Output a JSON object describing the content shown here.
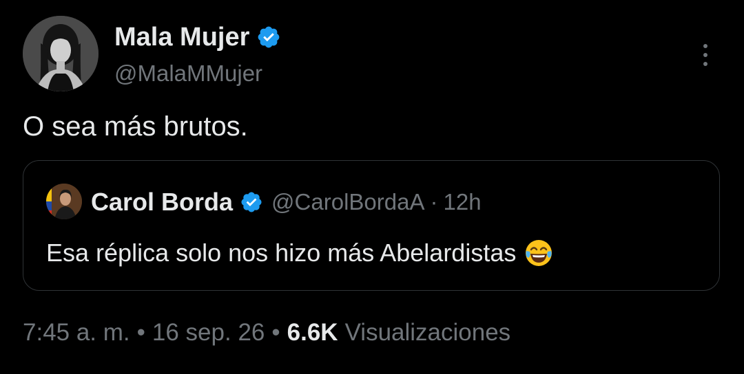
{
  "tweet": {
    "author": {
      "name": "Mala Mujer",
      "handle": "@MalaMMujer",
      "verified": true,
      "avatar_icon": "profile-photo-woman"
    },
    "text": "O sea más brutos.",
    "more_icon": "more-vertical-icon",
    "quote": {
      "author_name": "Carol Borda",
      "author_handle": "@CarolBordaA",
      "separator": "·",
      "time": "12h",
      "verified": true,
      "text": "Esa réplica solo nos hizo más Abelardistas",
      "emoji": "😂"
    },
    "meta": {
      "time": "7:45 a. m.",
      "dot1": "•",
      "date": "16 sep. 26",
      "dot2": "•",
      "views_count": "6.6K",
      "views_label": "Visualizaciones"
    }
  },
  "colors": {
    "background": "#000000",
    "text_primary": "#e7e9ea",
    "text_secondary": "#71767b",
    "verified_blue": "#1d9bf0",
    "border": "#2f3336"
  }
}
